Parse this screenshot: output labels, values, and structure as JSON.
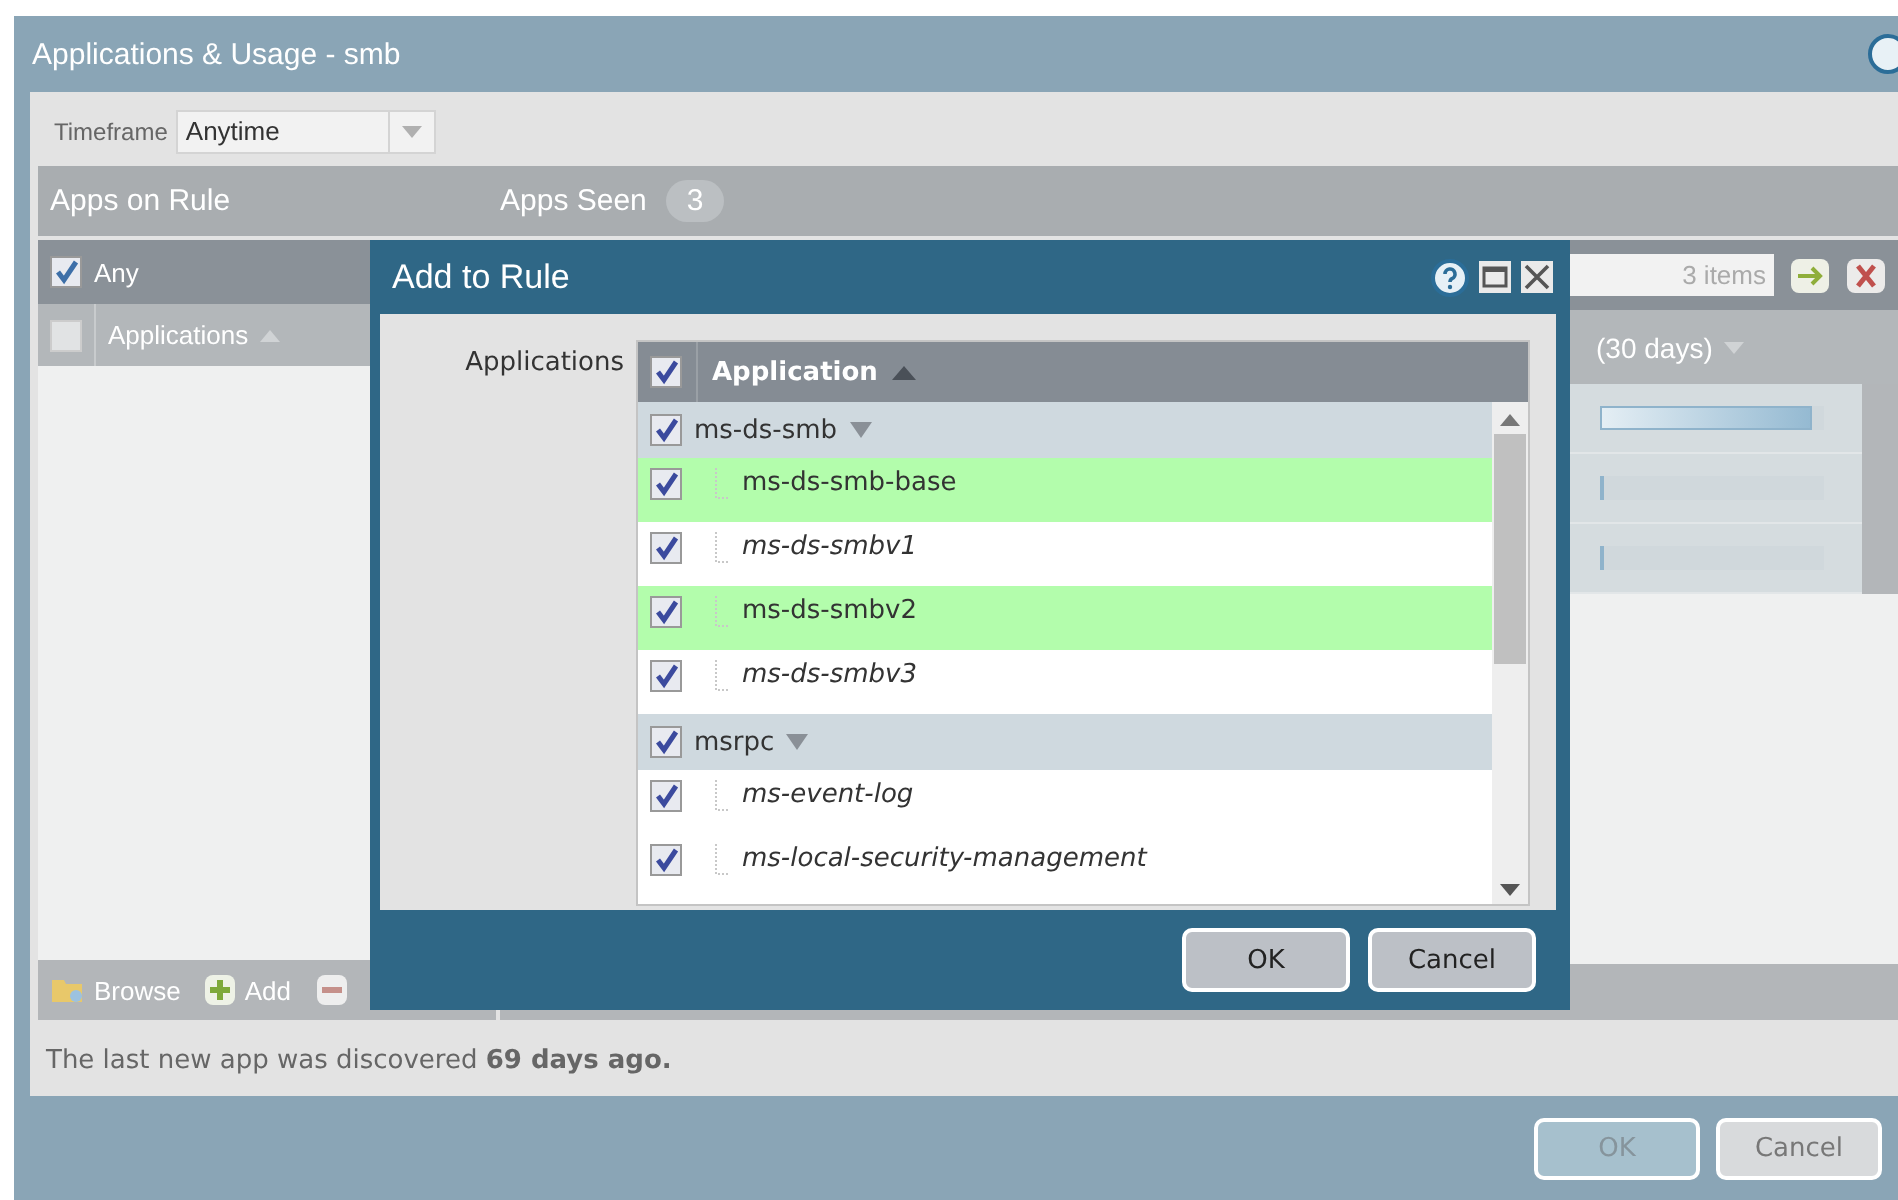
{
  "window": {
    "title": "Applications & Usage - smb"
  },
  "timeframe": {
    "label": "Timeframe",
    "value": "Anytime"
  },
  "panel_header": {
    "left_title": "Apps on Rule",
    "right_title": "Apps Seen",
    "apps_seen_count": "3"
  },
  "apps_on_rule": {
    "any": {
      "label": "Any",
      "checked": true
    },
    "column": {
      "label": "Applications",
      "checked": false
    },
    "toolbar": [
      {
        "kind": "browse",
        "label": "Browse"
      },
      {
        "kind": "add",
        "label": "Add"
      },
      {
        "kind": "remove"
      }
    ]
  },
  "apps_seen": {
    "item_count": "3 items",
    "column_header": "(30 days)",
    "rows": [
      {
        "level": 0.95
      },
      {
        "level": 0.02
      },
      {
        "level": 0.02
      }
    ]
  },
  "footer": "The last new app was discovered **69 days ago.**",
  "buttons": [
    {
      "label": "OK",
      "disabled": true
    },
    {
      "label": "Cancel",
      "disabled": false
    }
  ],
  "dialog": {
    "title": "Add to Rule",
    "field_label": "Applications",
    "header": {
      "label": "Application",
      "checked": true
    },
    "rows": [
      {
        "kind": "group",
        "label": "ms-ds-smb",
        "checked": true
      },
      {
        "kind": "child",
        "label": "ms-ds-smb-base",
        "checked": true,
        "highlighted": true,
        "italic": false
      },
      {
        "kind": "child",
        "label": "ms-ds-smbv1",
        "checked": true,
        "highlighted": false,
        "italic": true
      },
      {
        "kind": "child",
        "label": "ms-ds-smbv2",
        "checked": true,
        "highlighted": true,
        "italic": false
      },
      {
        "kind": "child",
        "label": "ms-ds-smbv3",
        "checked": true,
        "highlighted": false,
        "italic": true
      },
      {
        "kind": "group",
        "label": "msrpc",
        "checked": true
      },
      {
        "kind": "child",
        "label": "ms-event-log",
        "checked": true,
        "highlighted": false,
        "italic": true
      },
      {
        "kind": "child",
        "label": "ms-local-security-management",
        "checked": true,
        "highlighted": false,
        "italic": true
      }
    ],
    "buttons": [
      {
        "label": "OK"
      },
      {
        "label": "Cancel"
      }
    ]
  }
}
